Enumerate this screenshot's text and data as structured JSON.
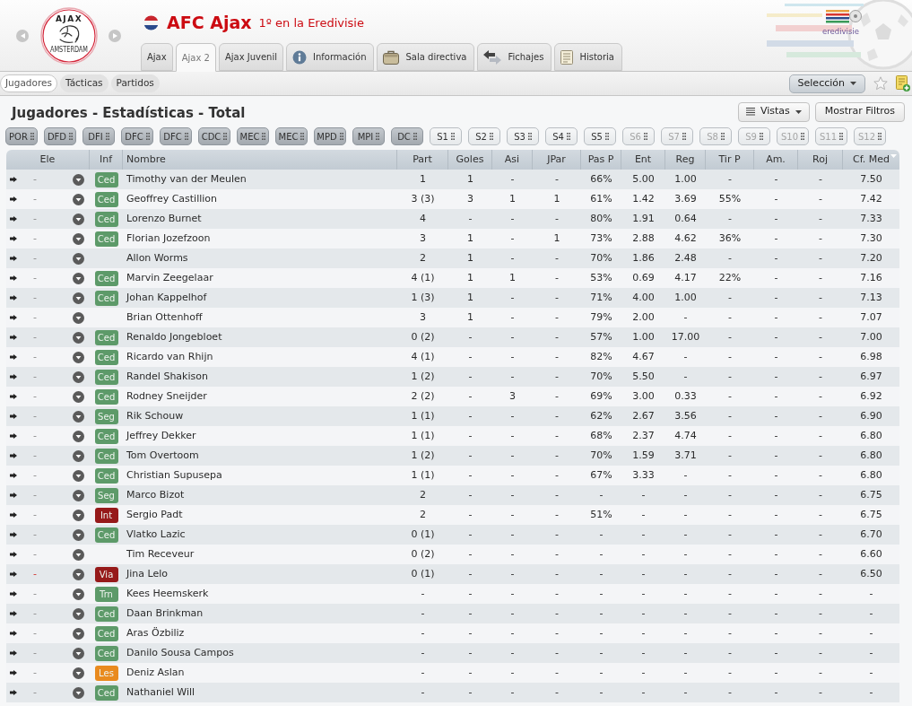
{
  "header": {
    "club_logo": {
      "top_text": "AJAX",
      "bottom_text": "AMSTERDAM"
    },
    "title": "AFC Ajax",
    "subtitle": "1º en la Eredivisie",
    "league_logo": {
      "text": "eredivisie"
    }
  },
  "tabs": [
    {
      "label": "Ajax",
      "kind": "plain",
      "selected": false
    },
    {
      "label": "Ajax 2",
      "kind": "plain",
      "selected": true
    },
    {
      "label": "Ajax Juvenil",
      "kind": "plain",
      "selected": false
    },
    {
      "label": "Información",
      "kind": "info",
      "selected": false
    },
    {
      "label": "Sala directiva",
      "kind": "board",
      "selected": false
    },
    {
      "label": "Fichajes",
      "kind": "transfers",
      "selected": false
    },
    {
      "label": "Historia",
      "kind": "history",
      "selected": false
    }
  ],
  "subnav": {
    "items": [
      {
        "label": "Jugadores",
        "selected": true
      },
      {
        "label": "Tácticas",
        "selected": false
      },
      {
        "label": "Partidos",
        "selected": false
      }
    ],
    "selection_button": "Selección"
  },
  "page": {
    "title": "Jugadores - Estadísticas - Total",
    "views_button": "Vistas",
    "filters_button": "Mostrar Filtros"
  },
  "filters": [
    {
      "label": "POR",
      "selected": true,
      "disabled": false
    },
    {
      "label": "DFD",
      "selected": true,
      "disabled": false
    },
    {
      "label": "DFI",
      "selected": true,
      "disabled": false
    },
    {
      "label": "DFC",
      "selected": true,
      "disabled": false
    },
    {
      "label": "DFC",
      "selected": true,
      "disabled": false
    },
    {
      "label": "CDC",
      "selected": true,
      "disabled": false
    },
    {
      "label": "MEC",
      "selected": true,
      "disabled": false
    },
    {
      "label": "MEC",
      "selected": true,
      "disabled": false
    },
    {
      "label": "MPD",
      "selected": true,
      "disabled": false
    },
    {
      "label": "MPI",
      "selected": true,
      "disabled": false
    },
    {
      "label": "DC",
      "selected": true,
      "disabled": false
    },
    {
      "label": "S1",
      "selected": false,
      "disabled": false
    },
    {
      "label": "S2",
      "selected": false,
      "disabled": false
    },
    {
      "label": "S3",
      "selected": false,
      "disabled": false
    },
    {
      "label": "S4",
      "selected": false,
      "disabled": false
    },
    {
      "label": "S5",
      "selected": false,
      "disabled": false
    },
    {
      "label": "S6",
      "selected": false,
      "disabled": true
    },
    {
      "label": "S7",
      "selected": false,
      "disabled": true
    },
    {
      "label": "S8",
      "selected": false,
      "disabled": true
    },
    {
      "label": "S9",
      "selected": false,
      "disabled": true
    },
    {
      "label": "S10",
      "selected": false,
      "disabled": true
    },
    {
      "label": "S11",
      "selected": false,
      "disabled": true
    },
    {
      "label": "S12",
      "selected": false,
      "disabled": true
    }
  ],
  "table": {
    "columns": [
      {
        "label": "Ele",
        "sorted": false
      },
      {
        "label": "Inf",
        "sorted": false
      },
      {
        "label": "Nombre",
        "sorted": false
      },
      {
        "label": "Part",
        "sorted": false
      },
      {
        "label": "Goles",
        "sorted": false
      },
      {
        "label": "Asi",
        "sorted": false
      },
      {
        "label": "JPar",
        "sorted": false
      },
      {
        "label": "Pas P",
        "sorted": false
      },
      {
        "label": "Ent",
        "sorted": false
      },
      {
        "label": "Reg",
        "sorted": false
      },
      {
        "label": "Tir P",
        "sorted": false
      },
      {
        "label": "Am.",
        "sorted": false
      },
      {
        "label": "Roj",
        "sorted": false
      },
      {
        "label": "Cf. Med",
        "sorted": true
      }
    ],
    "rows": [
      {
        "ele": "-",
        "ele_flagged": false,
        "badge": {
          "label": "Ced",
          "color": "#5d9a69"
        },
        "name": "Timothy van der Meulen",
        "stats": [
          "1",
          "1",
          "-",
          "-",
          "66%",
          "5.00",
          "1.00",
          "-",
          "-",
          "-",
          "7.50"
        ]
      },
      {
        "ele": "-",
        "ele_flagged": false,
        "badge": {
          "label": "Ced",
          "color": "#5d9a69"
        },
        "name": "Geoffrey Castillion",
        "stats": [
          "3 (3)",
          "3",
          "1",
          "1",
          "61%",
          "1.42",
          "3.69",
          "55%",
          "-",
          "-",
          "7.42"
        ]
      },
      {
        "ele": "-",
        "ele_flagged": false,
        "badge": {
          "label": "Ced",
          "color": "#5d9a69"
        },
        "name": "Lorenzo Burnet",
        "stats": [
          "4",
          "-",
          "-",
          "-",
          "80%",
          "1.91",
          "0.64",
          "-",
          "-",
          "-",
          "7.33"
        ]
      },
      {
        "ele": "-",
        "ele_flagged": false,
        "badge": {
          "label": "Ced",
          "color": "#5d9a69"
        },
        "name": "Florian Jozefzoon",
        "stats": [
          "3",
          "1",
          "-",
          "1",
          "73%",
          "2.88",
          "4.62",
          "36%",
          "-",
          "-",
          "7.30"
        ]
      },
      {
        "ele": "-",
        "ele_flagged": false,
        "name": "Allon Worms",
        "stats": [
          "2",
          "1",
          "-",
          "-",
          "70%",
          "1.86",
          "2.48",
          "-",
          "-",
          "-",
          "7.20"
        ]
      },
      {
        "ele": "-",
        "ele_flagged": false,
        "badge": {
          "label": "Ced",
          "color": "#5d9a69"
        },
        "name": "Marvin Zeegelaar",
        "stats": [
          "4 (1)",
          "1",
          "1",
          "-",
          "53%",
          "0.69",
          "4.17",
          "22%",
          "-",
          "-",
          "7.16"
        ]
      },
      {
        "ele": "-",
        "ele_flagged": false,
        "badge": {
          "label": "Ced",
          "color": "#5d9a69"
        },
        "name": "Johan Kappelhof",
        "stats": [
          "1 (3)",
          "1",
          "-",
          "-",
          "71%",
          "4.00",
          "1.00",
          "-",
          "-",
          "-",
          "7.13"
        ]
      },
      {
        "ele": "-",
        "ele_flagged": false,
        "name": "Brian Ottenhoff",
        "stats": [
          "3",
          "1",
          "-",
          "-",
          "79%",
          "2.00",
          "-",
          "-",
          "-",
          "-",
          "7.07"
        ]
      },
      {
        "ele": "-",
        "ele_flagged": false,
        "badge": {
          "label": "Ced",
          "color": "#5d9a69"
        },
        "name": "Renaldo Jongebloet",
        "stats": [
          "0 (2)",
          "-",
          "-",
          "-",
          "57%",
          "1.00",
          "17.00",
          "-",
          "-",
          "-",
          "7.00"
        ]
      },
      {
        "ele": "-",
        "ele_flagged": false,
        "badge": {
          "label": "Ced",
          "color": "#5d9a69"
        },
        "name": "Ricardo van Rhijn",
        "stats": [
          "4 (1)",
          "-",
          "-",
          "-",
          "82%",
          "4.67",
          "-",
          "-",
          "-",
          "-",
          "6.98"
        ]
      },
      {
        "ele": "-",
        "ele_flagged": false,
        "badge": {
          "label": "Ced",
          "color": "#5d9a69"
        },
        "name": "Randel Shakison",
        "stats": [
          "1 (2)",
          "-",
          "-",
          "-",
          "70%",
          "5.50",
          "-",
          "-",
          "-",
          "-",
          "6.97"
        ]
      },
      {
        "ele": "-",
        "ele_flagged": false,
        "badge": {
          "label": "Ced",
          "color": "#5d9a69"
        },
        "name": "Rodney Sneijder",
        "stats": [
          "2 (2)",
          "-",
          "3",
          "-",
          "69%",
          "3.00",
          "0.33",
          "-",
          "-",
          "-",
          "6.92"
        ]
      },
      {
        "ele": "-",
        "ele_flagged": false,
        "badge": {
          "label": "Seg",
          "color": "#5d9a69"
        },
        "name": "Rik Schouw",
        "stats": [
          "1 (1)",
          "-",
          "-",
          "-",
          "62%",
          "2.67",
          "3.56",
          "-",
          "-",
          "-",
          "6.90"
        ]
      },
      {
        "ele": "-",
        "ele_flagged": false,
        "badge": {
          "label": "Ced",
          "color": "#5d9a69"
        },
        "name": "Jeffrey Dekker",
        "stats": [
          "1 (1)",
          "-",
          "-",
          "-",
          "68%",
          "2.37",
          "4.74",
          "-",
          "-",
          "-",
          "6.80"
        ]
      },
      {
        "ele": "-",
        "ele_flagged": false,
        "badge": {
          "label": "Ced",
          "color": "#5d9a69"
        },
        "name": "Tom Overtoom",
        "stats": [
          "1 (2)",
          "-",
          "-",
          "-",
          "70%",
          "1.59",
          "3.71",
          "-",
          "-",
          "-",
          "6.80"
        ]
      },
      {
        "ele": "-",
        "ele_flagged": false,
        "badge": {
          "label": "Ced",
          "color": "#5d9a69"
        },
        "name": "Christian Supusepa",
        "stats": [
          "1 (1)",
          "-",
          "-",
          "-",
          "67%",
          "3.33",
          "-",
          "-",
          "-",
          "-",
          "6.80"
        ]
      },
      {
        "ele": "-",
        "ele_flagged": false,
        "badge": {
          "label": "Seg",
          "color": "#5d9a69"
        },
        "name": "Marco Bizot",
        "stats": [
          "2",
          "-",
          "-",
          "-",
          "-",
          "-",
          "-",
          "-",
          "-",
          "-",
          "6.75"
        ]
      },
      {
        "ele": "-",
        "ele_flagged": false,
        "badge": {
          "label": "Int",
          "color": "#961a1a"
        },
        "name": "Sergio Padt",
        "stats": [
          "2",
          "-",
          "-",
          "-",
          "51%",
          "-",
          "-",
          "-",
          "-",
          "-",
          "6.75"
        ]
      },
      {
        "ele": "-",
        "ele_flagged": false,
        "badge": {
          "label": "Ced",
          "color": "#5d9a69"
        },
        "name": "Vlatko Lazic",
        "stats": [
          "0 (1)",
          "-",
          "-",
          "-",
          "-",
          "-",
          "-",
          "-",
          "-",
          "-",
          "6.70"
        ]
      },
      {
        "ele": "-",
        "ele_flagged": false,
        "name": "Tim Receveur",
        "stats": [
          "0 (2)",
          "-",
          "-",
          "-",
          "-",
          "-",
          "-",
          "-",
          "-",
          "-",
          "6.60"
        ]
      },
      {
        "ele": "-",
        "ele_flagged": true,
        "badge": {
          "label": "Via",
          "color": "#961a1a"
        },
        "name": "Jina Lelo",
        "stats": [
          "0 (1)",
          "-",
          "-",
          "-",
          "-",
          "-",
          "-",
          "-",
          "-",
          "-",
          "6.50"
        ]
      },
      {
        "ele": "-",
        "ele_flagged": false,
        "badge": {
          "label": "Trn",
          "color": "#5d9a69"
        },
        "name": "Kees Heemskerk",
        "stats": [
          "-",
          "-",
          "-",
          "-",
          "-",
          "-",
          "-",
          "-",
          "-",
          "-",
          "-"
        ]
      },
      {
        "ele": "-",
        "ele_flagged": false,
        "badge": {
          "label": "Ced",
          "color": "#5d9a69"
        },
        "name": "Daan Brinkman",
        "stats": [
          "-",
          "-",
          "-",
          "-",
          "-",
          "-",
          "-",
          "-",
          "-",
          "-",
          "-"
        ]
      },
      {
        "ele": "-",
        "ele_flagged": false,
        "badge": {
          "label": "Ced",
          "color": "#5d9a69"
        },
        "name": "Aras Özbiliz",
        "stats": [
          "-",
          "-",
          "-",
          "-",
          "-",
          "-",
          "-",
          "-",
          "-",
          "-",
          "-"
        ]
      },
      {
        "ele": "-",
        "ele_flagged": false,
        "badge": {
          "label": "Ced",
          "color": "#5d9a69"
        },
        "name": "Danilo Sousa Campos",
        "stats": [
          "-",
          "-",
          "-",
          "-",
          "-",
          "-",
          "-",
          "-",
          "-",
          "-",
          "-"
        ]
      },
      {
        "ele": "-",
        "ele_flagged": false,
        "badge": {
          "label": "Les",
          "color": "#e98a1e"
        },
        "name": "Deniz Aslan",
        "stats": [
          "-",
          "-",
          "-",
          "-",
          "-",
          "-",
          "-",
          "-",
          "-",
          "-",
          "-"
        ]
      },
      {
        "ele": "-",
        "ele_flagged": false,
        "badge": {
          "label": "Ced",
          "color": "#5d9a69"
        },
        "name": "Nathaniel Will",
        "stats": [
          "-",
          "-",
          "-",
          "-",
          "-",
          "-",
          "-",
          "-",
          "-",
          "-",
          "-"
        ]
      }
    ]
  }
}
